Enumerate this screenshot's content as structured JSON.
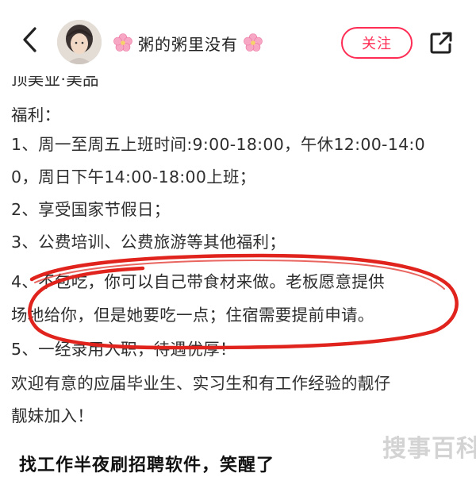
{
  "header": {
    "author_name": "粥的粥里没有",
    "follow_label": "关注",
    "back_icon": "chevron-left-icon",
    "share_icon": "share-external-icon",
    "author_decoration": "cherry-blossom-icon",
    "accent_color": "#ff2d55"
  },
  "post": {
    "cut_line": "顶美业·美品",
    "lines": [
      "福利：",
      "1、周一至周五上班时间:9:00-18:00，午休12:00-14:0",
      "0，周日下午14:00-18:00上班；",
      "2、享受国家节假日；",
      "3、公费培训、公费旅游等其他福利；",
      "4、不包吃，你可以自己带食材来做。老板愿意提供",
      "场地给你，但是她要吃一点；住宿需要提前申请。",
      "5、一经录用入职，待遇优厚！",
      "欢迎有意的应届毕业生、实习生和有工作经验的靓仔",
      "靓妹加入！"
    ],
    "highlight_color": "#e0231c"
  },
  "caption": "找工作半夜刷招聘软件，笑醒了",
  "watermark": "搜事百科"
}
